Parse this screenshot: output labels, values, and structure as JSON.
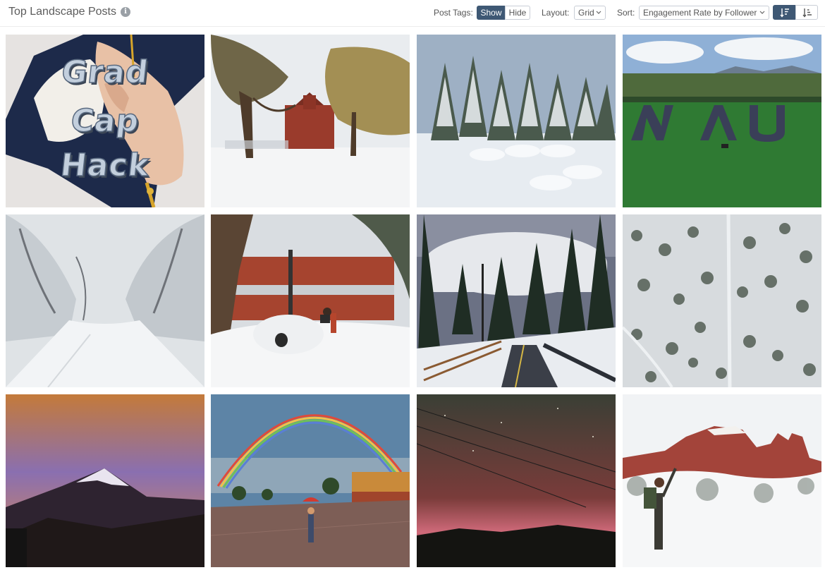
{
  "header": {
    "title": "Top Landscape Posts",
    "info_icon": "info-circle-icon",
    "post_tags": {
      "label": "Post Tags:",
      "options": [
        "Show",
        "Hide"
      ],
      "selected": "Show"
    },
    "layout": {
      "label": "Layout:",
      "value": "Grid"
    },
    "sort": {
      "label": "Sort:",
      "value": "Engagement Rate by Follower",
      "directions": [
        "sort-descending-icon",
        "sort-ascending-icon"
      ],
      "selected_direction": "sort-descending-icon"
    }
  },
  "colors": {
    "accent": "#3e5874",
    "border": "#c9ced6"
  },
  "posts": [
    {
      "id": "post-1",
      "overlay_lines": [
        "Grad",
        "Cap",
        "Hack"
      ]
    },
    {
      "id": "post-2"
    },
    {
      "id": "post-3"
    },
    {
      "id": "post-4",
      "overlay_lines": []
    },
    {
      "id": "post-5"
    },
    {
      "id": "post-6"
    },
    {
      "id": "post-7"
    },
    {
      "id": "post-8"
    },
    {
      "id": "post-9"
    },
    {
      "id": "post-10"
    },
    {
      "id": "post-11"
    },
    {
      "id": "post-12"
    }
  ]
}
